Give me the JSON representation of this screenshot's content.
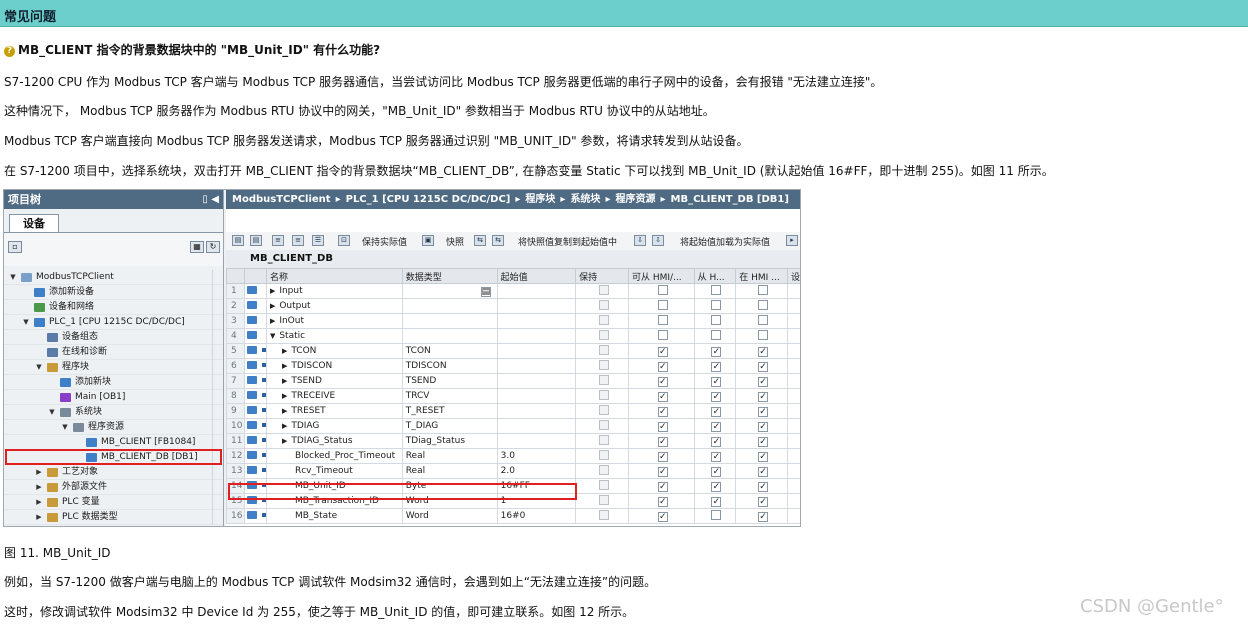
{
  "header": {
    "title": "常见问题"
  },
  "question": "MB_CLIENT 指令的背景数据块中的 \"MB_Unit_ID\" 有什么功能?",
  "paragraphs": [
    "S7-1200 CPU 作为 Modbus TCP 客户端与 Modbus TCP 服务器通信，当尝试访问比 Modbus TCP 服务器更低端的串行子网中的设备，会有报错 \"无法建立连接\"。",
    "这种情况下， Modbus TCP 服务器作为 Modbus RTU 协议中的网关，\"MB_Unit_ID\" 参数相当于 Modbus RTU 协议中的从站地址。",
    "Modbus TCP 客户端直接向 Modbus TCP 服务器发送请求，Modbus TCP 服务器通过识别 \"MB_UNIT_ID\" 参数，将请求转发到从站设备。",
    "在 S7-1200 项目中，选择系统块，双击打开 MB_CLIENT 指令的背景数据块“MB_CLIENT_DB”, 在静态变量 Static 下可以找到 MB_Unit_ID (默认起始值 16#FF，即十进制 255)。如图 11 所示。"
  ],
  "screenshot": {
    "project_tree": {
      "title": "项目树",
      "tab": "设备",
      "items": [
        {
          "label": "ModbusTCPClient",
          "level": 0,
          "expanded": true
        },
        {
          "label": "添加新设备",
          "level": 1
        },
        {
          "label": "设备和网络",
          "level": 1
        },
        {
          "label": "PLC_1 [CPU 1215C DC/DC/DC]",
          "level": 1,
          "expanded": true
        },
        {
          "label": "设备组态",
          "level": 2
        },
        {
          "label": "在线和诊断",
          "level": 2
        },
        {
          "label": "程序块",
          "level": 2,
          "expanded": true
        },
        {
          "label": "添加新块",
          "level": 3
        },
        {
          "label": "Main [OB1]",
          "level": 3
        },
        {
          "label": "系统块",
          "level": 3,
          "expanded": true
        },
        {
          "label": "程序资源",
          "level": 4,
          "expanded": true
        },
        {
          "label": "MB_CLIENT [FB1084]",
          "level": 5
        },
        {
          "label": "MB_CLIENT_DB [DB1]",
          "level": 5,
          "highlight": true
        },
        {
          "label": "工艺对象",
          "level": 2,
          "collapsed": true
        },
        {
          "label": "外部源文件",
          "level": 2,
          "collapsed": true
        },
        {
          "label": "PLC 变量",
          "level": 2,
          "collapsed": true
        },
        {
          "label": "PLC 数据类型",
          "level": 2,
          "collapsed": true
        }
      ]
    },
    "breadcrumb": [
      "ModbusTCPClient",
      "PLC_1 [CPU 1215C DC/DC/DC]",
      "程序块",
      "系统块",
      "程序资源",
      "MB_CLIENT_DB [DB1]"
    ],
    "toolbar": {
      "keep_actual": "保持实际值",
      "snapshot": "快照",
      "copy_snapshot": "将快照值复制到起始值中",
      "load_start": "将起始值加载为实际值"
    },
    "db_name": "MB_CLIENT_DB",
    "columns": [
      "名称",
      "数据类型",
      "起始值",
      "保持",
      "可从 HMI/...",
      "从 H...",
      "在 HMI ...",
      "设"
    ],
    "rows": [
      {
        "num": "1",
        "name": "Input",
        "type": "",
        "start": "",
        "tree": "collapsed",
        "indent": 0,
        "c1": false,
        "c2": false,
        "c3": false,
        "c4": false,
        "dis": false,
        "btn": true
      },
      {
        "num": "2",
        "name": "Output",
        "type": "",
        "start": "",
        "tree": "collapsed",
        "indent": 0,
        "c1": false,
        "c2": false,
        "c3": false,
        "c4": false
      },
      {
        "num": "3",
        "name": "InOut",
        "type": "",
        "start": "",
        "tree": "collapsed",
        "indent": 0,
        "c1": false,
        "c2": false,
        "c3": false,
        "c4": false
      },
      {
        "num": "4",
        "name": "Static",
        "type": "",
        "start": "",
        "tree": "expanded",
        "indent": 0,
        "c1": false,
        "c2": false,
        "c3": false,
        "c4": false
      },
      {
        "num": "5",
        "name": "TCON",
        "type": "TCON",
        "start": "",
        "tree": "collapsed",
        "indent": 1,
        "c1": false,
        "c2": true,
        "c3": true,
        "c4": true
      },
      {
        "num": "6",
        "name": "TDISCON",
        "type": "TDISCON",
        "start": "",
        "tree": "collapsed",
        "indent": 1,
        "c1": false,
        "c2": true,
        "c3": true,
        "c4": true
      },
      {
        "num": "7",
        "name": "TSEND",
        "type": "TSEND",
        "start": "",
        "tree": "collapsed",
        "indent": 1,
        "c1": false,
        "c2": true,
        "c3": true,
        "c4": true
      },
      {
        "num": "8",
        "name": "TRECEIVE",
        "type": "TRCV",
        "start": "",
        "tree": "collapsed",
        "indent": 1,
        "c1": false,
        "c2": true,
        "c3": true,
        "c4": true
      },
      {
        "num": "9",
        "name": "TRESET",
        "type": "T_RESET",
        "start": "",
        "tree": "collapsed",
        "indent": 1,
        "c1": false,
        "c2": true,
        "c3": true,
        "c4": true
      },
      {
        "num": "10",
        "name": "TDIAG",
        "type": "T_DIAG",
        "start": "",
        "tree": "collapsed",
        "indent": 1,
        "c1": false,
        "c2": true,
        "c3": true,
        "c4": true
      },
      {
        "num": "11",
        "name": "TDIAG_Status",
        "type": "TDiag_Status",
        "start": "",
        "tree": "collapsed",
        "indent": 1,
        "c1": false,
        "c2": true,
        "c3": true,
        "c4": true
      },
      {
        "num": "12",
        "name": "Blocked_Proc_Timeout",
        "type": "Real",
        "start": "3.0",
        "tree": "none",
        "indent": 1,
        "c1": false,
        "c2": true,
        "c3": true,
        "c4": true
      },
      {
        "num": "13",
        "name": "Rcv_Timeout",
        "type": "Real",
        "start": "2.0",
        "tree": "none",
        "indent": 1,
        "c1": false,
        "c2": true,
        "c3": true,
        "c4": true
      },
      {
        "num": "14",
        "name": "MB_Unit_ID",
        "type": "Byte",
        "start": "16#FF",
        "tree": "none",
        "indent": 1,
        "c1": false,
        "c2": true,
        "c3": true,
        "c4": true,
        "highlight": true
      },
      {
        "num": "15",
        "name": "MB_Transaction_ID",
        "type": "Word",
        "start": "1",
        "tree": "none",
        "indent": 1,
        "c1": false,
        "c2": true,
        "c3": true,
        "c4": true
      },
      {
        "num": "16",
        "name": "MB_State",
        "type": "Word",
        "start": "16#0",
        "tree": "none",
        "indent": 1,
        "c1": false,
        "c2": true,
        "c3": false,
        "c4": true
      }
    ]
  },
  "figure_caption": "图 11. MB_Unit_ID",
  "after_paragraphs": [
    "例如，当 S7-1200 做客户端与电脑上的 Modbus TCP 调试软件 Modsim32 通信时，会遇到如上“无法建立连接”的问题。",
    "这时，修改调试软件 Modsim32 中 Device Id 为 255，使之等于 MB_Unit_ID 的值，即可建立联系。如图 12 所示。"
  ],
  "watermark": "CSDN @Gentle°",
  "colors": {
    "header_bg": "#6ccfcb",
    "highlight_border": "#e02020",
    "title_bar": "#4f6a83"
  }
}
